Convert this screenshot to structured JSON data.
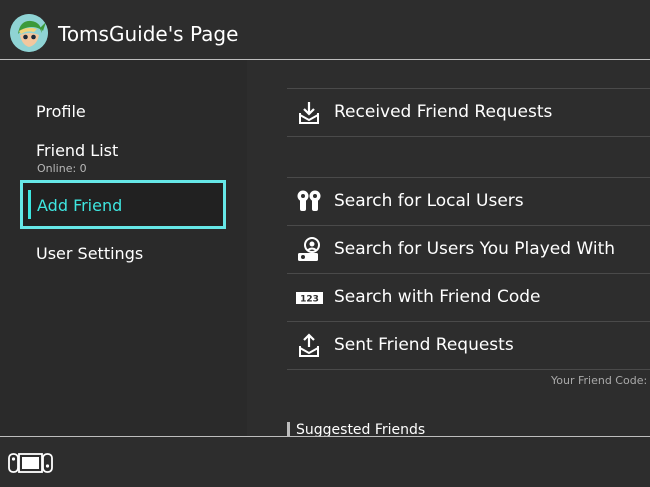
{
  "header": {
    "title": "TomsGuide's Page",
    "avatar_icon": "link-avatar-icon"
  },
  "sidebar": {
    "items": [
      {
        "label": "Profile"
      },
      {
        "label": "Friend List",
        "sub": "Online: 0"
      },
      {
        "label": "Add Friend",
        "selected": true
      },
      {
        "label": "User Settings"
      }
    ]
  },
  "main": {
    "rows": [
      {
        "label": "Received Friend Requests",
        "icon": "inbox-download-icon"
      },
      {
        "label": "Search for Local Users",
        "icon": "local-users-icon"
      },
      {
        "label": "Search for Users You Played With",
        "icon": "played-with-icon"
      },
      {
        "label": "Search with Friend Code",
        "icon": "friend-code-123-icon"
      },
      {
        "label": "Sent Friend Requests",
        "icon": "outbox-upload-icon"
      }
    ],
    "friend_code_label": "Your Friend Code:",
    "suggested_heading": "Suggested Friends"
  },
  "footer": {
    "icon": "switch-console-icon"
  },
  "colors": {
    "accent": "#3ee6e0",
    "selection_border": "#66e7e7",
    "background": "#2d2d2d"
  }
}
